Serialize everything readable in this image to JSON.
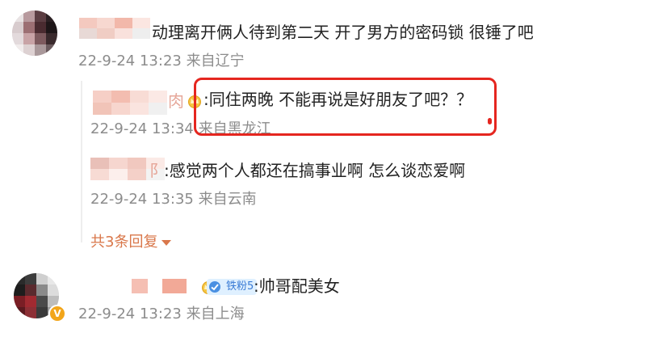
{
  "comments": [
    {
      "text": "动理离开俩人待到第二天 开了男方的密码锁 很锤了吧",
      "meta": "22-9-24 13:23 来自辽宁",
      "replies": [
        {
          "text": ":同住两晚 不能再说是好朋友了吧？？",
          "meta": "22-9-24 13:34 来自黑龙江",
          "name_fragment": "肉"
        },
        {
          "text": ":感觉两个人都还在搞事业啊 怎么谈恋爱啊",
          "meta": "22-9-24 13:35 来自云南",
          "name_fragment": "阝"
        }
      ],
      "expand_label": "共3条回复"
    },
    {
      "text": ":帅哥配美女",
      "meta": "22-9-24 13:23 来自上海",
      "fan_badge": "铁粉5"
    }
  ],
  "colors": {
    "highlight": "#e5261f",
    "expand": "#d9774a",
    "meta": "#8c8c8c"
  }
}
